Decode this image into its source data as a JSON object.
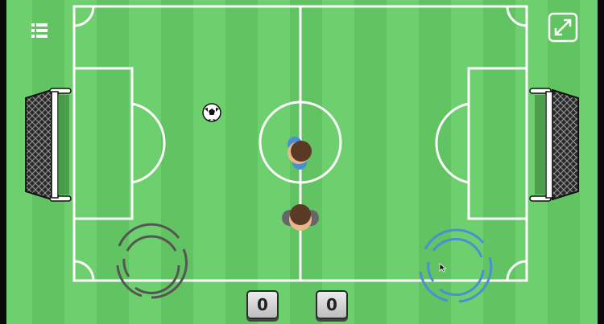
{
  "score": {
    "left": "0",
    "right": "0"
  },
  "icons": {
    "menu": "list-icon",
    "fullscreen": "expand-diagonal-icon"
  },
  "colors": {
    "pitch_light": "#6ecf6e",
    "pitch_dark": "#62c362",
    "lines": "#ffffff",
    "team_blue": "#4a90d0",
    "team_gray": "#666666",
    "hair": "#5a3a24"
  }
}
